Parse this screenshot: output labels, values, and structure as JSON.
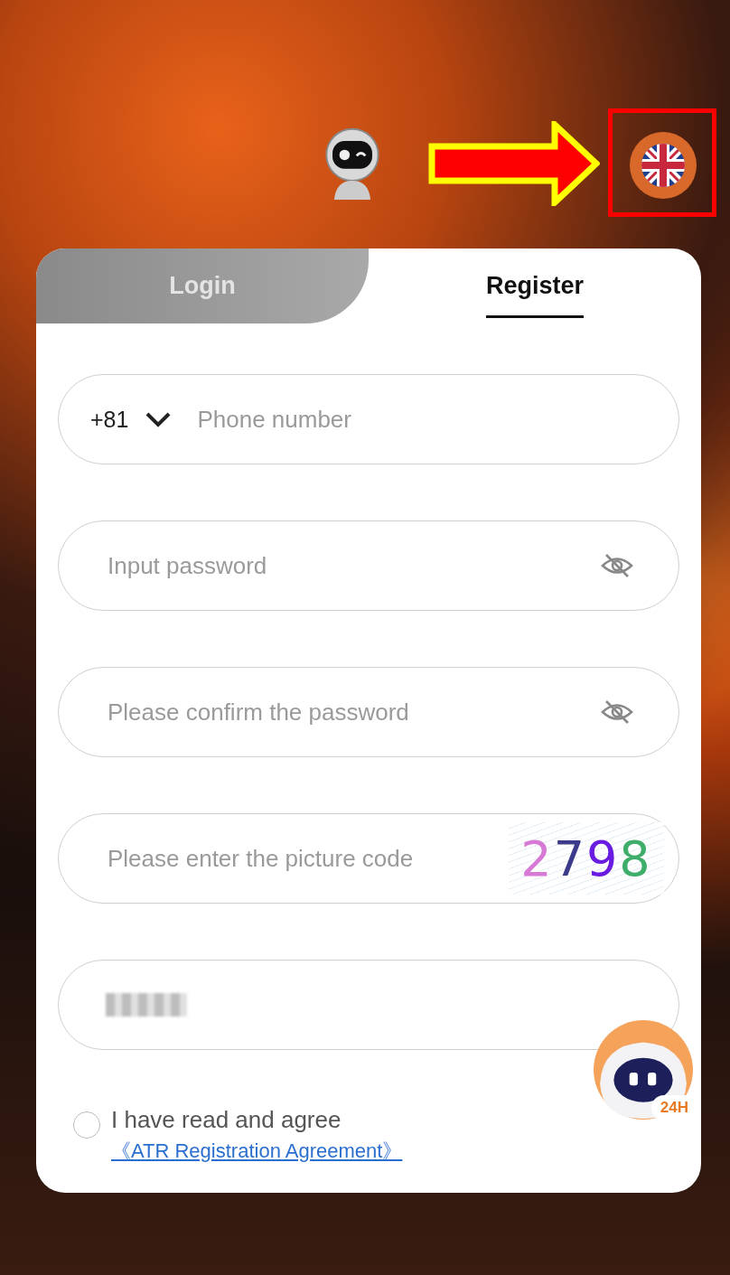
{
  "tabs": [
    {
      "label": "Login",
      "selected": false
    },
    {
      "label": "Register",
      "selected": true
    }
  ],
  "fields": [
    {
      "kind": "phone",
      "country_code": "+81",
      "placeholder": "Phone number"
    },
    {
      "kind": "password",
      "placeholder": "Input password"
    },
    {
      "kind": "password",
      "placeholder": "Please confirm the password"
    },
    {
      "kind": "captcha",
      "placeholder": "Please enter the picture code",
      "captcha_code": "2798"
    },
    {
      "kind": "redacted"
    }
  ],
  "agreement": {
    "checked": false,
    "text": "I have read and agree",
    "link": "《ATR Registration Agreement》"
  },
  "support_badge": "24H"
}
